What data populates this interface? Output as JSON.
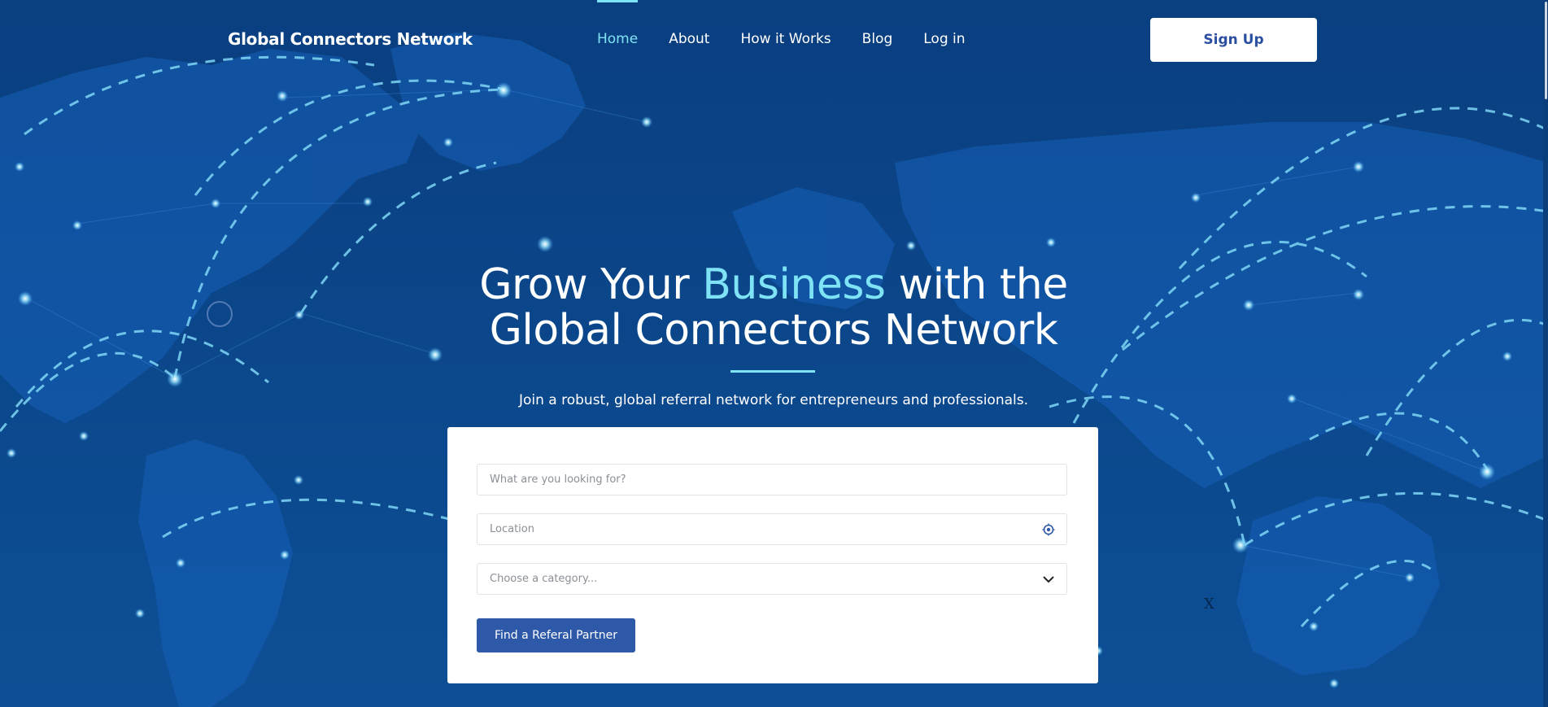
{
  "brand": "Global Connectors Network",
  "nav": {
    "items": [
      {
        "label": "Home",
        "active": true
      },
      {
        "label": "About"
      },
      {
        "label": "How it Works"
      },
      {
        "label": "Blog"
      },
      {
        "label": "Log in"
      }
    ],
    "signup_label": "Sign Up"
  },
  "hero": {
    "title_part1": "Grow Your ",
    "title_accent": "Business",
    "title_part2": " with the",
    "title_line2": "Global Connectors Network",
    "subtitle": "Join a robust, global referral network for entrepreneurs and professionals."
  },
  "search": {
    "looking_for_placeholder": "What are you looking for?",
    "location_placeholder": "Location",
    "category_placeholder": "Choose a category...",
    "submit_label": "Find a Referal Partner"
  },
  "close_label": "X",
  "colors": {
    "background": "#0c4a90",
    "accent": "#7fe3f6",
    "button": "#2e59a8"
  },
  "icons": {
    "location": "locate-icon",
    "dropdown": "chevron-down-icon"
  }
}
